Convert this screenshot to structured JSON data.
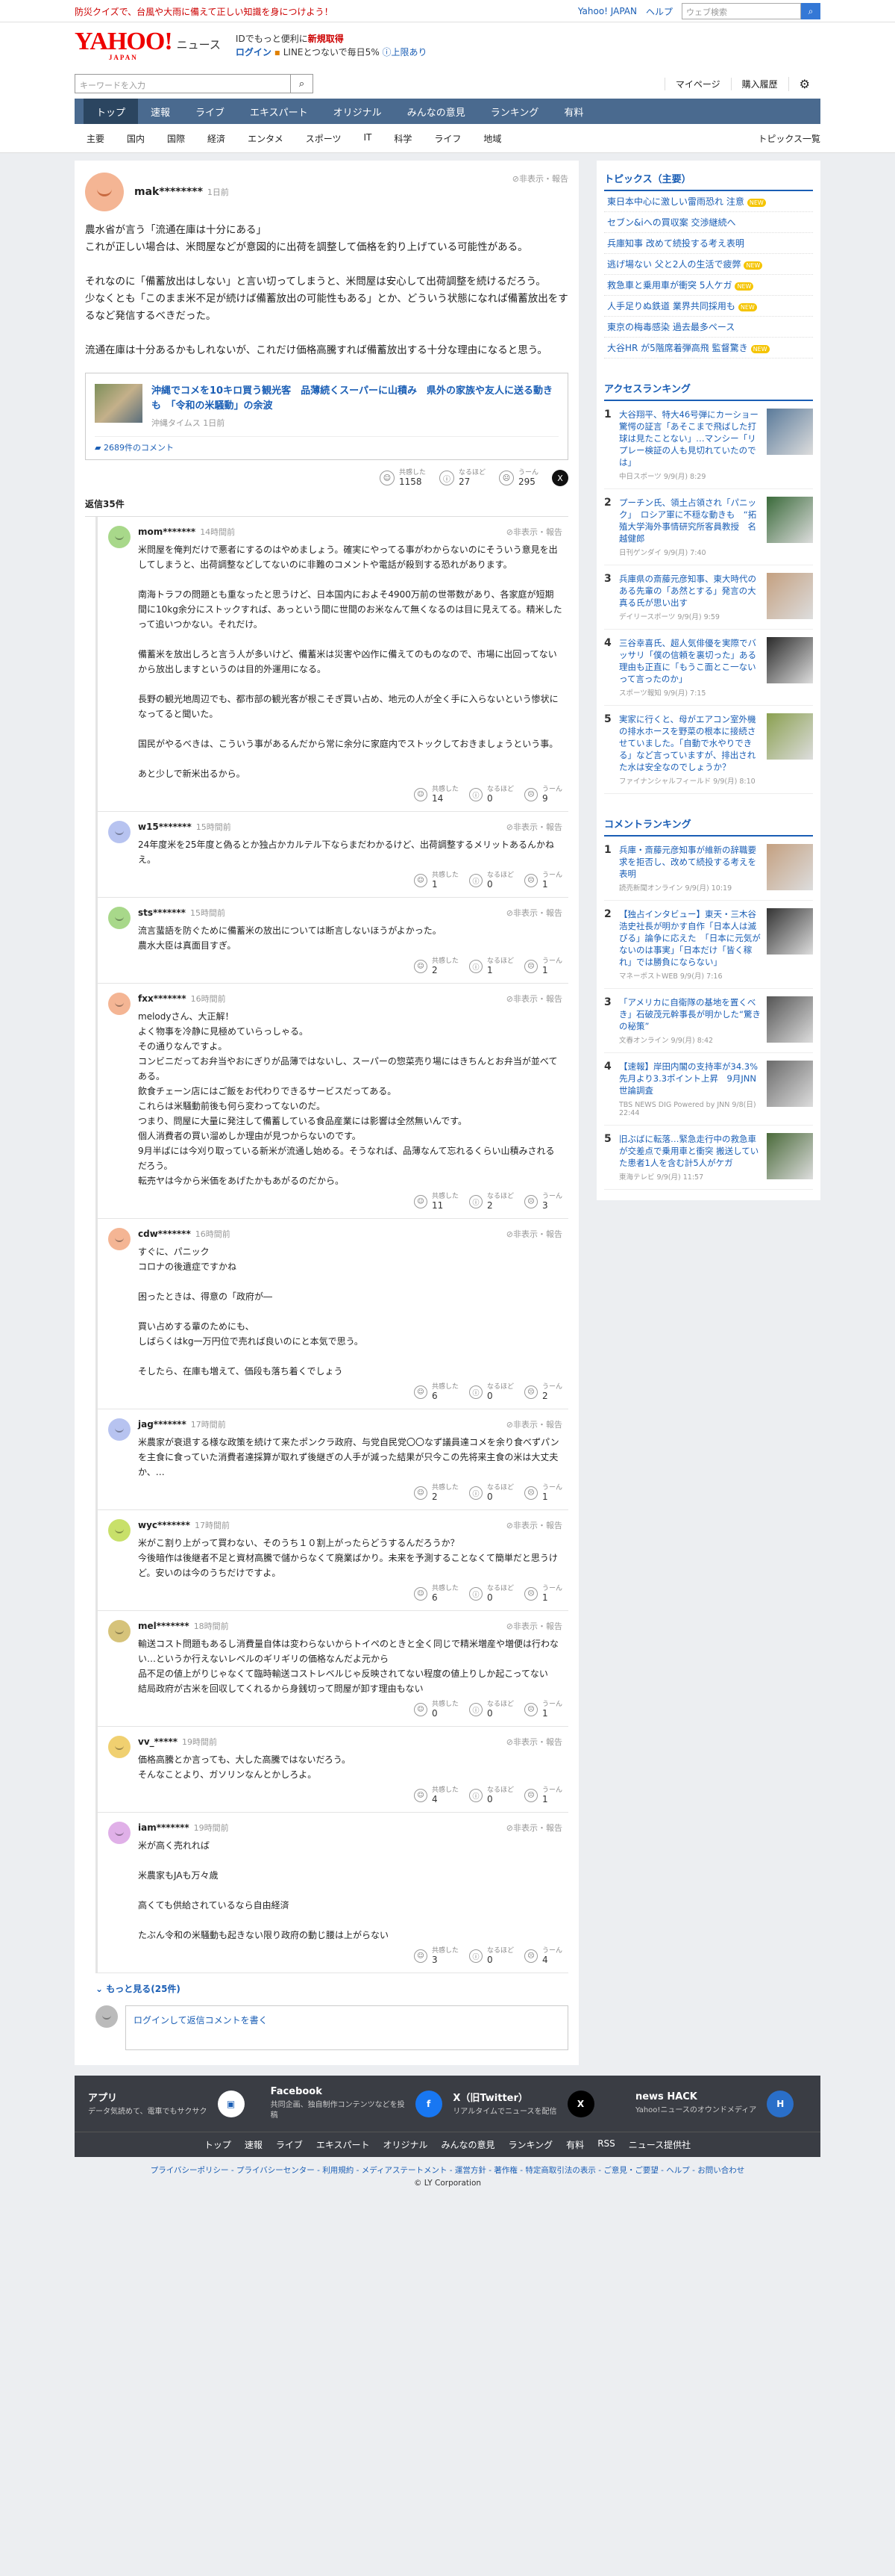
{
  "topstrip": {
    "promo": "防災クイズで、台風や大雨に備えて正しい知識を身につけよう！",
    "yahoo_link": "Yahoo! JAPAN",
    "help_link": "ヘルプ",
    "search_placeholder": "ウェブ検索"
  },
  "header": {
    "logo_main": "YAHOO!",
    "logo_sub": "JAPAN",
    "logo_news": "ニュース",
    "promo_line1_a": "IDでもっと便利に",
    "promo_line1_b": "新規取得",
    "promo_line2_login": "ログイン",
    "promo_line2_text": "LINEとつないで毎日5% ",
    "promo_line2_more": "上限あり"
  },
  "searchrow": {
    "placeholder": "キーワードを入力",
    "mypage": "マイページ",
    "purchase": "購入履歴"
  },
  "nav": [
    "トップ",
    "速報",
    "ライブ",
    "エキスパート",
    "オリジナル",
    "みんなの意見",
    "ランキング",
    "有料"
  ],
  "subnav": [
    "主要",
    "国内",
    "国際",
    "経済",
    "エンタメ",
    "スポーツ",
    "IT",
    "科学",
    "ライフ",
    "地域"
  ],
  "subnav_topics": "トピックス一覧",
  "comment": {
    "user": "mak********",
    "time": "1日前",
    "report": "非表示・報告",
    "text": "農水省が言う「流通在庫は十分にある」\nこれが正しい場合は、米問屋などが意図的に出荷を調整して価格を釣り上げている可能性がある。\n\nそれなのに「備蓄放出はしない」と言い切ってしまうと、米問屋は安心して出荷調整を続けるだろう。\n少なくとも「このまま米不足が続けば備蓄放出の可能性もある」とか、どういう状態になれば備蓄放出をするなど発信するべきだった。\n\n流通在庫は十分あるかもしれないが、これだけ価格高騰すれば備蓄放出する十分な理由になると思う。",
    "article_title": "沖縄でコメを10キロ買う観光客　品薄続くスーパーに山積み　県外の家族や友人に送る動きも　「令和の米騒動」の余波",
    "article_source": "沖縄タイムス 1日前",
    "article_comments": "2689件のコメント",
    "reactions": [
      {
        "label": "共感した",
        "count": "1158"
      },
      {
        "label": "なるほど",
        "count": "27"
      },
      {
        "label": "うーん",
        "count": "295"
      }
    ],
    "reply_count": "返信35件"
  },
  "replies": [
    {
      "user": "mom*******",
      "time": "14時間前",
      "color": "#a8d88a",
      "text": "米問屋を俺判だけで悪者にするのはやめましょう。確実にやってる事がわからないのにそういう意見を出してしまうと、出荷調整などしてないのに非難のコメントや電話が殺到する恐れがあります。\n\n南海トラフの問題とも重なったと思うけど、日本国内におよそ4900万前の世帯数があり、各家庭が短期間に10kg余分にストックすれば、あっという間に世間のお米なんて無くなるのは目に見えてる。精米したって追いつかない。それだけ。\n\n備蓄米を放出しろと言う人が多いけど、備蓄米は災害や凶作に備えてのものなので、市場に出回ってないから放出しますというのは目的外運用になる。\n\n長野の観光地周辺でも、都市部の観光客が根こそぎ買い占め、地元の人が全く手に入らないという惨状になってると聞いた。\n\n国民がやるべきは、こういう事があるんだから常に余分に家庭内でストックしておきましょうという事。\n\nあと少しで新米出るから。",
      "r": [
        "14",
        "0",
        "9"
      ]
    },
    {
      "user": "w15*******",
      "time": "15時間前",
      "color": "#b7c3f0",
      "text": "24年度米を25年度と偽るとか独占かカルテル下ならまだわかるけど、出荷調整するメリットあるんかねえ。",
      "r": [
        "1",
        "0",
        "1"
      ]
    },
    {
      "user": "sts*******",
      "time": "15時間前",
      "color": "#a8d88a",
      "text": "流言蜚語を防ぐために備蓄米の放出については断言しないほうがよかった。\n農水大臣は真面目すぎ。",
      "r": [
        "2",
        "1",
        "1"
      ]
    },
    {
      "user": "fxx*******",
      "time": "16時間前",
      "color": "#f4b594",
      "text": "melodyさん、大正解！\nよく物事を冷静に見極めていらっしゃる。\nその通りなんですよ。\nコンビニだってお弁当やおにぎりが品薄ではないし、スーパーの惣菜売り場にはきちんとお弁当が並べてある。\n飲食チェーン店にはご飯をお代わりできるサービスだってある。\nこれらは米騒動前後も何ら変わってないのだ。\nつまり、問屋に大量に発注して備蓄している食品産業には影響は全然無いんです。\n個人消費者の買い溜めしか理由が見つからないのです。\n9月半ばには今刈り取っている新米が流通し始める。そうなれば、品薄なんて忘れるくらい山積みされるだろう。\n転売ヤは今から米価をあげたかもあがるのだから。",
      "r": [
        "11",
        "2",
        "3"
      ]
    },
    {
      "user": "cdw*******",
      "time": "16時間前",
      "color": "#f4b594",
      "text": "すぐに、パニック\nコロナの後遺症ですかね\n\n困ったときは、得意の「政府が―\n\n買い占めする輩のためにも、\nしばらくはkg一万円位で売れば良いのにと本気で思う。\n\nそしたら、在庫も増えて、価段も落ち着くでしょう",
      "r": [
        "6",
        "0",
        "2"
      ]
    },
    {
      "user": "jag*******",
      "time": "17時間前",
      "color": "#b7c3f0",
      "text": "米農家が衰退する様な政策を続けて来たポンクラ政府、与党自民党〇〇なず議員達コメを余り食べずパンを主食に食っていた消費者達採算が取れず後継ぎの人手が減った結果が只今この先将来主食の米は大丈夫か、…",
      "r": [
        "2",
        "0",
        "1"
      ]
    },
    {
      "user": "wyc*******",
      "time": "17時間前",
      "color": "#c8e06a",
      "text": "米がこ割り上がって買わない、そのうち１０割上がったらどうするんだろうか？\n今後暗作は後継者不足と資材高騰で儲からなくて廃業ばかり。未来を予測することなくて簡単だと思うけど。安いのは今のうちだけですよ。",
      "r": [
        "6",
        "0",
        "1"
      ]
    },
    {
      "user": "mel*******",
      "time": "18時間前",
      "color": "#d6c37a",
      "text": "輸送コスト問題もあるし消費量自体は変わらないからトイペのときと全く同じで精米増産や増便は行わない…というか行えないレベルのギリギリの価格なんだよ元から\n品不足の値上がりじゃなくて臨時輸送コストレベルじゃ反映されてない程度の値上りしか起こってない\n結局政府が古米を回収してくれるから身銭切って問屋が卸す理由もない",
      "r": [
        "0",
        "0",
        "1"
      ]
    },
    {
      "user": "vv_*****",
      "time": "19時間前",
      "color": "#f0d070",
      "text": "価格高騰とか言っても、大した高騰ではないだろう。\nそんなことより、ガソリンなんとかしろよ。",
      "r": [
        "4",
        "0",
        "1"
      ]
    },
    {
      "user": "iam*******",
      "time": "19時間前",
      "color": "#e0b0e8",
      "text": "米が高く売れれば\n\n米農家もJAも万々歳\n\n高くても供給されているなら自由経済\n\nたぶん令和の米騒動も起きない限り政府の動じ腰は上がらない",
      "r": [
        "3",
        "0",
        "4"
      ]
    }
  ],
  "more_replies": "もっと見る(25件)",
  "reply_form": "ログインして返信コメントを書く",
  "right": {
    "topics_title": "トピックス（主要）",
    "topics": [
      {
        "t": "東日本中心に激しい雷雨恐れ 注意",
        "new": true
      },
      {
        "t": "セブン&iへの買収案 交渉継続へ",
        "new": false
      },
      {
        "t": "兵庫知事 改めて続投する考え表明",
        "new": false
      },
      {
        "t": "逃げ場ない 父と2人の生活で疲弊",
        "new": true
      },
      {
        "t": "救急車と乗用車が衝突 5人ケガ",
        "new": true
      },
      {
        "t": "人手足りぬ鉄道 業界共同採用も",
        "new": true
      },
      {
        "t": "東京の梅毒感染 過去最多ペース",
        "new": false
      },
      {
        "t": "大谷HR が5階席着弾高飛 監督驚き",
        "new": true
      }
    ],
    "access_title": "アクセスランキング",
    "access": [
      {
        "t": "大谷翔平、特大46号弾にカーショー驚愕の証言「あそこまで飛ばした打球は見たことない」…マンシー「リプレー検証の人も見切れていたのでは」",
        "src": "中日スポーツ 9/9(月) 8:29",
        "color": "#5a7a9a"
      },
      {
        "t": "プーチン氏、領土占領され「パニック」　ロシア軍に不穏な動きも　“拓殖大学海外事情研究所客員教授　名越健郎",
        "src": "日刊ゲンダイ 9/9(月) 7:40",
        "color": "#3a6a3a"
      },
      {
        "t": "兵庫県の斎藤元彦知事、東大時代のある先輩の「あ然とする」発言の大真る氏が思い出す",
        "src": "デイリースポーツ 9/9(月) 9:59",
        "color": "#c4a080"
      },
      {
        "t": "三谷幸喜氏、超人気俳優を実際でバッサリ「僕の信頼を裏切った」ある理由も正直に「もうこ面とこ一ないって言ったのか」",
        "src": "スポーツ報知 9/9(月) 7:15",
        "color": "#2a2a2a"
      },
      {
        "t": "実家に行くと、母がエアコン室外機の排水ホースを野菜の根本に接続させていました。「自動で水やりできる」など言っていますが、排出された水は安全なのでしょうか？",
        "src": "ファイナンシャルフィールド 9/9(月) 8:10",
        "color": "#8aa050"
      }
    ],
    "comment_title": "コメントランキング",
    "commentrank": [
      {
        "t": "兵庫・斎藤元彦知事が維新の辞職要求を拒否し、改めて続投する考えを表明",
        "src": "読売新聞オンライン 9/9(月) 10:19",
        "color": "#c4a080"
      },
      {
        "t": "【独占インタビュー】東天・三木谷浩史社長が明かす自作「日本人は滅びる」論争に応えた　「日本に元気がないのは事実」「日本だけ「皆く稼れ」では勝負にならない」",
        "src": "マネーポストWEB 9/9(月) 7:16",
        "color": "#333"
      },
      {
        "t": "「アメリカに自衛隊の基地を置くべき」石破茂元幹事長が明かした“驚きの秘策”",
        "src": "文春オンライン 9/9(月) 8:42",
        "color": "#555"
      },
      {
        "t": "【速報】岸田内閣の支持率が34.3%　先月より3.3ポイント上昇　9月JNN世論調査",
        "src": "TBS NEWS DIG Powered by JNN 9/8(日) 22:44",
        "color": "#6a6a6a"
      },
      {
        "t": "旧ぶばに転落…緊急走行中の救急車が交差点で乗用車と衝突 搬送していた患者1人を含む計5人がケガ",
        "src": "東海テレビ 9/9(月) 11:57",
        "color": "#4a6a3a"
      }
    ]
  },
  "footer": {
    "cols": [
      {
        "t": "アプリ",
        "d": "データ気読めて、電車でもサクサク",
        "icon": "app-icon"
      },
      {
        "t": "Facebook",
        "d": "共同企画、独自制作コンテンツなどを投稿",
        "icon": "facebook-icon"
      },
      {
        "t": "X（旧Twitter）",
        "d": "リアルタイムでニュースを配信",
        "icon": "x-icon"
      },
      {
        "t": "news HACK",
        "d": "Yahoo!ニュースのオウンドメディア",
        "icon": "newshack-icon"
      }
    ],
    "links": [
      "トップ",
      "速報",
      "ライブ",
      "エキスパート",
      "オリジナル",
      "みんなの意見",
      "ランキング",
      "有料",
      "RSS",
      "ニュース提供社"
    ],
    "bottom": "プライバシーポリシー - プライバシーセンター - 利用規約 - メディアステートメント - 運営方針 - 著作権 - 特定商取引法の表示 - ご意見・ご要望 - ヘルプ - お問い合わせ",
    "copy": "© LY Corporation"
  },
  "colors": {
    "accent": "#1a5eb5",
    "nav": "#4a6a8f",
    "footer": "#3a3d44",
    "promo_red": "#cc0000"
  }
}
